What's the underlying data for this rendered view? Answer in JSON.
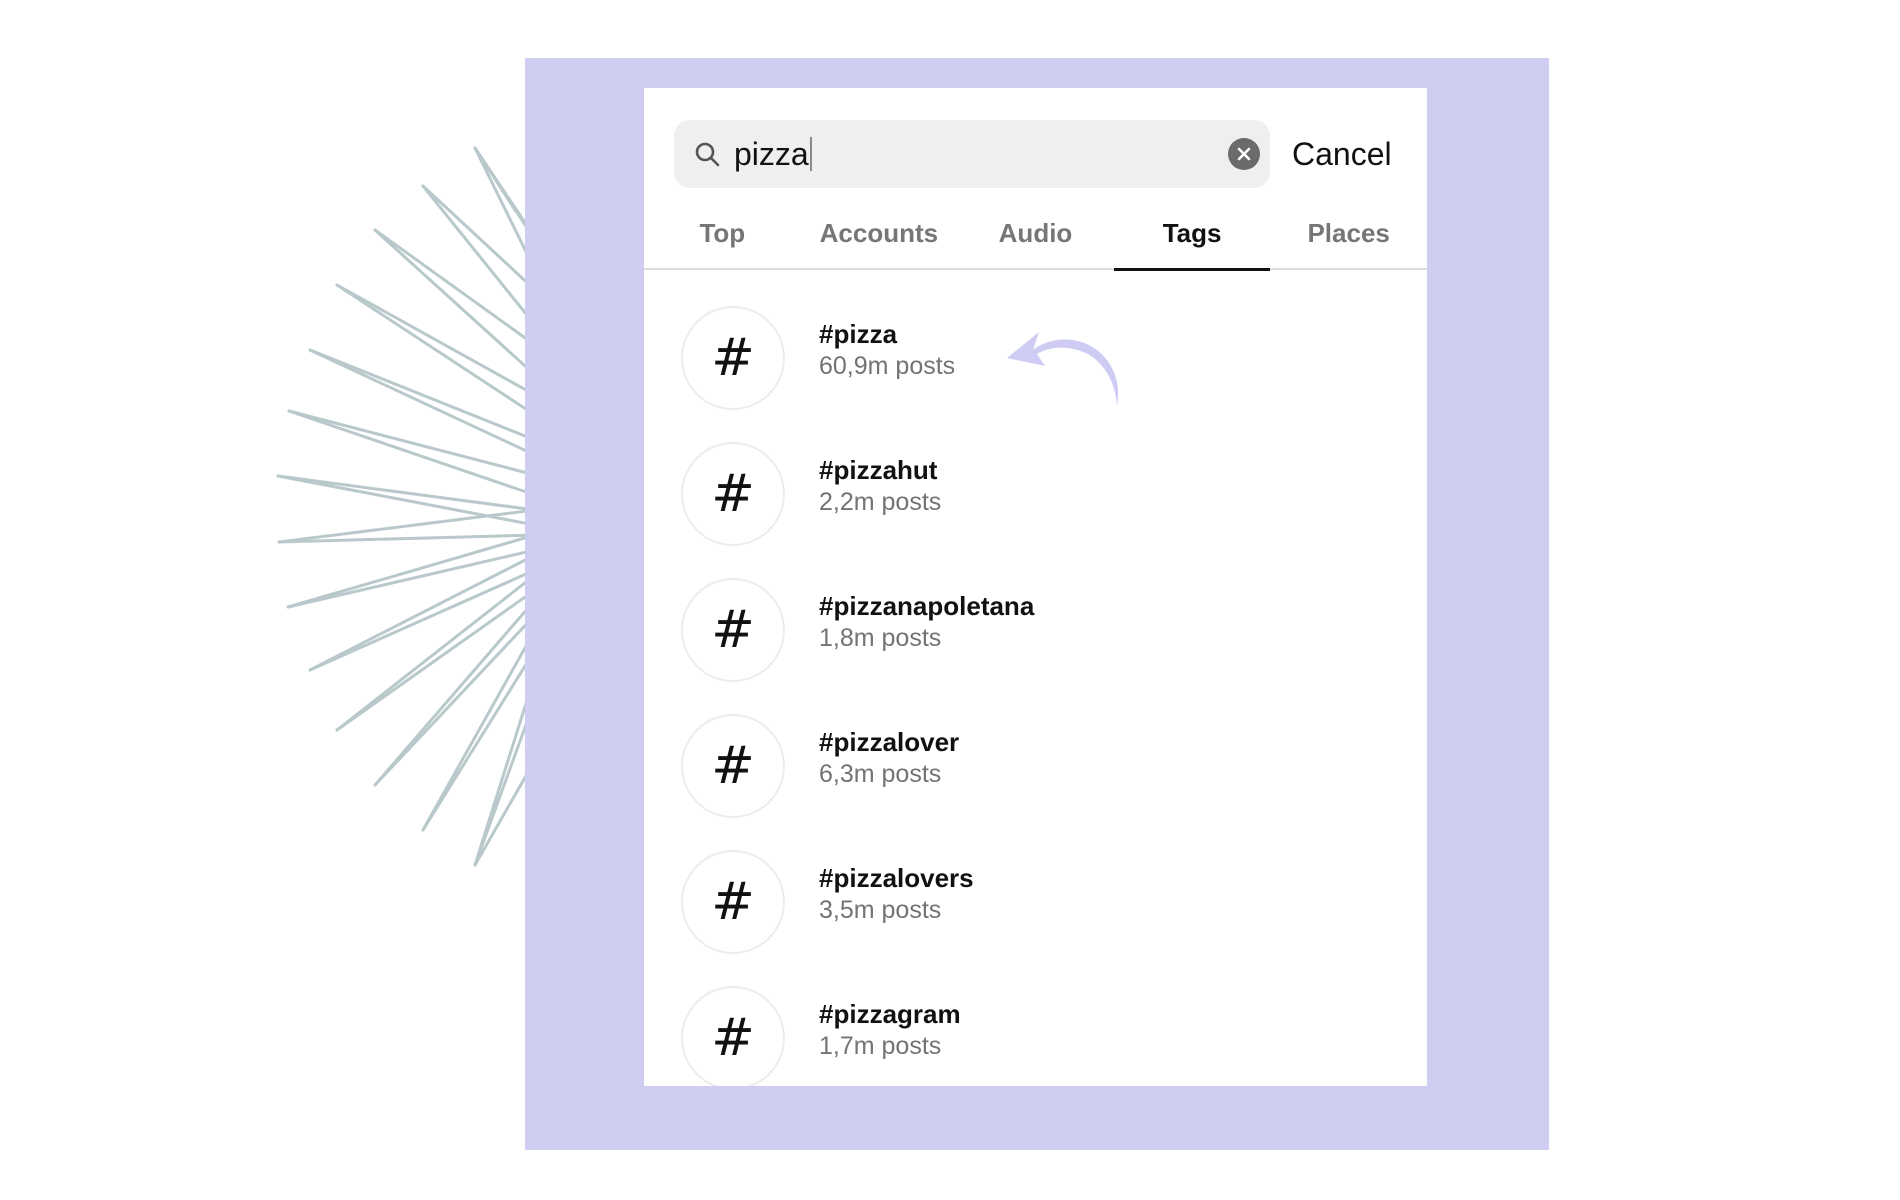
{
  "search": {
    "query": "pizza",
    "cancel_label": "Cancel"
  },
  "tabs": [
    {
      "label": "Top",
      "active": false
    },
    {
      "label": "Accounts",
      "active": false
    },
    {
      "label": "Audio",
      "active": false
    },
    {
      "label": "Tags",
      "active": true
    },
    {
      "label": "Places",
      "active": false
    }
  ],
  "results": [
    {
      "icon": "#",
      "name": "#pizza",
      "count": "60,9m posts"
    },
    {
      "icon": "#",
      "name": "#pizzahut",
      "count": "2,2m posts"
    },
    {
      "icon": "#",
      "name": "#pizzanapoletana",
      "count": "1,8m posts"
    },
    {
      "icon": "#",
      "name": "#pizzalover",
      "count": "6,3m posts"
    },
    {
      "icon": "#",
      "name": "#pizzalovers",
      "count": "3,5m posts"
    },
    {
      "icon": "#",
      "name": "#pizzagram",
      "count": "1,7m posts"
    }
  ],
  "colors": {
    "background_panel": "#d0cdf3",
    "arrow": "#cfccf4",
    "burst_lines": "#b9c9cb",
    "active_tab": "#111111",
    "inactive_tab": "#767676"
  }
}
